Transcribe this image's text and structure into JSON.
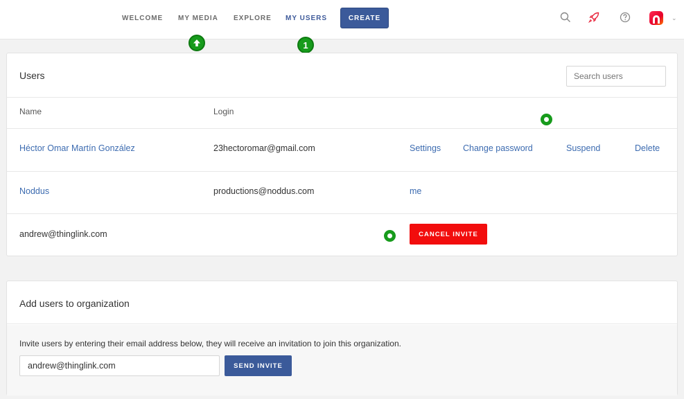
{
  "nav": {
    "welcome": "WELCOME",
    "my_media": "MY MEDIA",
    "explore": "EXPLORE",
    "my_users": "MY USERS",
    "create": "CREATE"
  },
  "markers": {
    "step_one": "1"
  },
  "users_card": {
    "title": "Users",
    "search_placeholder": "Search users",
    "col_name": "Name",
    "col_login": "Login",
    "rows": [
      {
        "name": "Héctor Omar Martín González",
        "login": "23hectoromar@gmail.com",
        "settings": "Settings",
        "change_password": "Change password",
        "suspend": "Suspend",
        "delete": "Delete"
      },
      {
        "name": "Noddus",
        "login": "productions@noddus.com",
        "me": "me"
      },
      {
        "name": "andrew@thinglink.com",
        "cancel_invite": "CANCEL INVITE"
      }
    ]
  },
  "add_card": {
    "title": "Add users to organization",
    "instructions": "Invite users by entering their email address below, they will receive an invitation to join this organization.",
    "email_value": "andrew@thinglink.com",
    "send_invite": "SEND INVITE"
  },
  "colors": {
    "primary": "#3b5a9a",
    "link": "#3c6bb0",
    "danger": "#f20d0d",
    "marker": "#179b1c"
  }
}
